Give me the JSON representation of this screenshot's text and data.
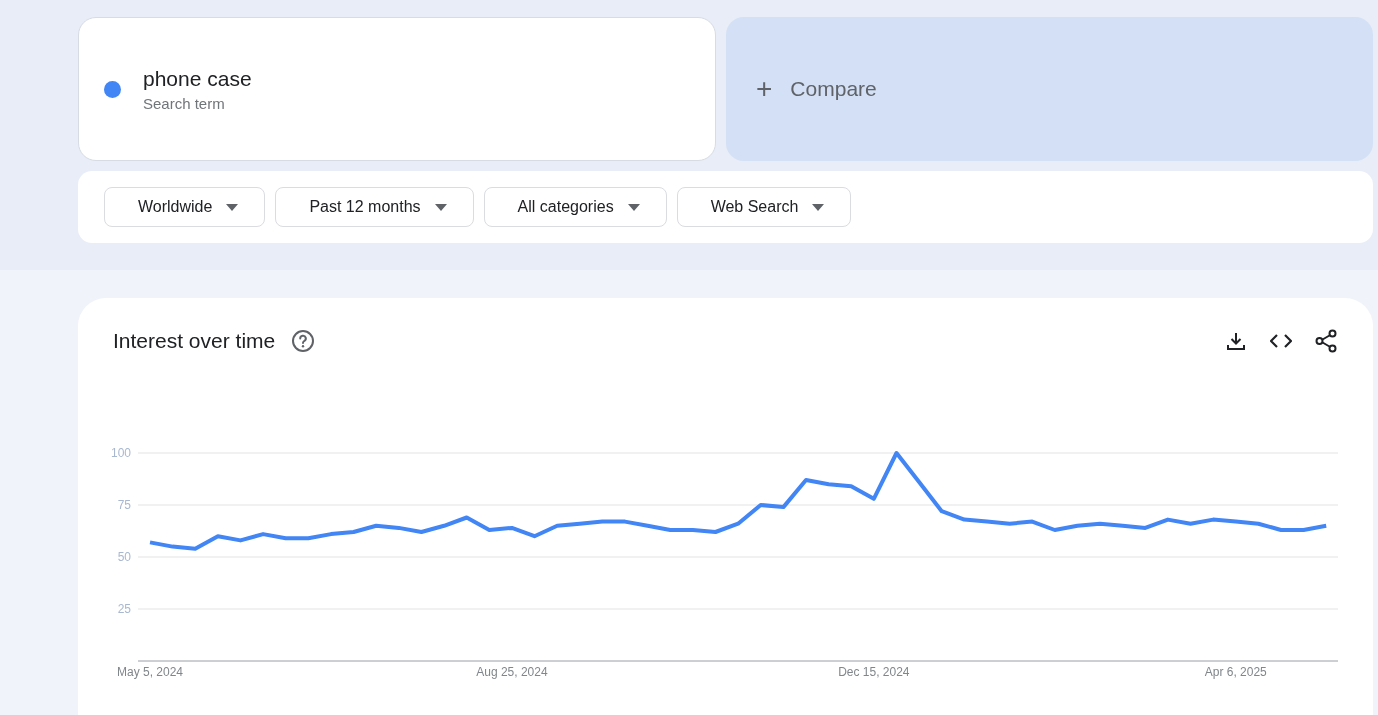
{
  "search_term": {
    "label": "phone case",
    "sublabel": "Search term",
    "color": "#4285f4"
  },
  "compare": {
    "label": "Compare",
    "icon": "+"
  },
  "filters": [
    {
      "label": "Worldwide"
    },
    {
      "label": "Past 12 months"
    },
    {
      "label": "All categories"
    },
    {
      "label": "Web Search"
    }
  ],
  "interest_over_time": {
    "title": "Interest over time",
    "chart_data": {
      "type": "line",
      "grid": true,
      "x": [
        "May 5, 2024",
        null,
        null,
        null,
        null,
        null,
        null,
        null,
        null,
        null,
        null,
        null,
        null,
        null,
        null,
        null,
        "Aug 25, 2024",
        null,
        null,
        null,
        null,
        null,
        null,
        null,
        null,
        null,
        null,
        null,
        null,
        null,
        null,
        null,
        "Dec 15, 2024",
        null,
        null,
        null,
        null,
        null,
        null,
        null,
        null,
        null,
        null,
        null,
        null,
        null,
        null,
        null,
        "Apr 6, 2025",
        null,
        null,
        null,
        null
      ],
      "series": [
        {
          "color": "#4285f4",
          "values": [
            57,
            55,
            54,
            60,
            58,
            61,
            59,
            59,
            61,
            62,
            65,
            64,
            62,
            65,
            69,
            63,
            64,
            60,
            65,
            66,
            67,
            67,
            65,
            63,
            63,
            62,
            66,
            75,
            74,
            87,
            85,
            84,
            78,
            100,
            86,
            72,
            68,
            67,
            66,
            67,
            63,
            65,
            66,
            65,
            64,
            68,
            66,
            68,
            67,
            66,
            63,
            63,
            65
          ]
        }
      ],
      "ylim": [
        0,
        100
      ],
      "yticks": [
        25,
        50,
        75,
        100
      ]
    }
  }
}
